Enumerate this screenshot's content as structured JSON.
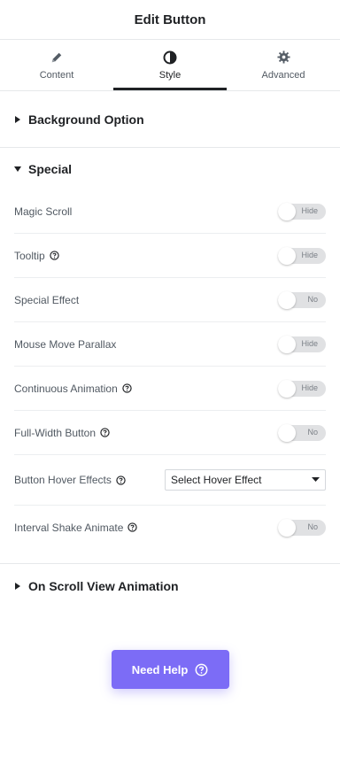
{
  "header": {
    "title": "Edit Button"
  },
  "tabs": [
    {
      "label": "Content",
      "icon": "pencil-icon",
      "active": false
    },
    {
      "label": "Style",
      "icon": "contrast-icon",
      "active": true
    },
    {
      "label": "Advanced",
      "icon": "gear-icon",
      "active": false
    }
  ],
  "sections": {
    "background": {
      "title": "Background Option",
      "expanded": false
    },
    "special": {
      "title": "Special",
      "expanded": true
    },
    "scroll_view": {
      "title": "On Scroll View Animation",
      "expanded": false
    }
  },
  "special_controls": [
    {
      "label": "Magic Scroll",
      "help": false,
      "type": "switch",
      "value": "Hide"
    },
    {
      "label": "Tooltip",
      "help": true,
      "type": "switch",
      "value": "Hide"
    },
    {
      "label": "Special Effect",
      "help": false,
      "type": "switch",
      "value": "No"
    },
    {
      "label": "Mouse Move Parallax",
      "help": false,
      "type": "switch",
      "value": "Hide"
    },
    {
      "label": "Continuous Animation",
      "help": true,
      "type": "switch",
      "value": "Hide"
    },
    {
      "label": "Full-Width Button",
      "help": true,
      "type": "switch",
      "value": "No"
    },
    {
      "label": "Button Hover Effects",
      "help": true,
      "type": "select",
      "value": "Select Hover Effect"
    },
    {
      "label": "Interval Shake Animate",
      "help": true,
      "type": "switch",
      "value": "No"
    }
  ],
  "help_button": {
    "label": "Need Help"
  },
  "colors": {
    "accent": "#7c6cf6",
    "text": "#1f2124",
    "muted": "#515962",
    "switch_off": "#e0e1e3"
  }
}
